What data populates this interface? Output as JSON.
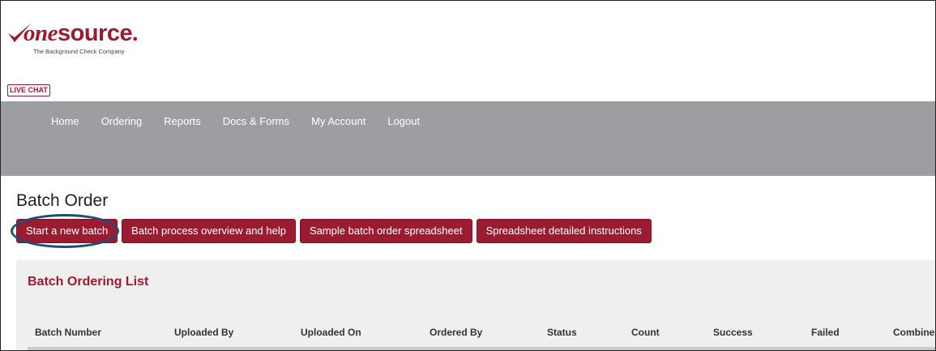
{
  "logo": {
    "word_one": "one",
    "word_source": "source",
    "dot": ".",
    "tagline": "The Background Check Company"
  },
  "live_chat": "LIVE CHAT",
  "nav": [
    "Home",
    "Ordering",
    "Reports",
    "Docs & Forms",
    "My Account",
    "Logout"
  ],
  "page_title": "Batch Order",
  "buttons": [
    "Start a new batch",
    "Batch process overview and help",
    "Sample batch order spreadsheet",
    "Spreadsheet detailed instructions"
  ],
  "panel": {
    "title": "Batch Ordering List",
    "columns": [
      "Batch Number",
      "Uploaded By",
      "Uploaded On",
      "Ordered By",
      "Status",
      "Count",
      "Success",
      "Failed",
      "Combined"
    ]
  },
  "colors": {
    "brand": "#9b1b30",
    "navbar": "#9d9ea2",
    "highlight_ring": "#1c4f74"
  }
}
